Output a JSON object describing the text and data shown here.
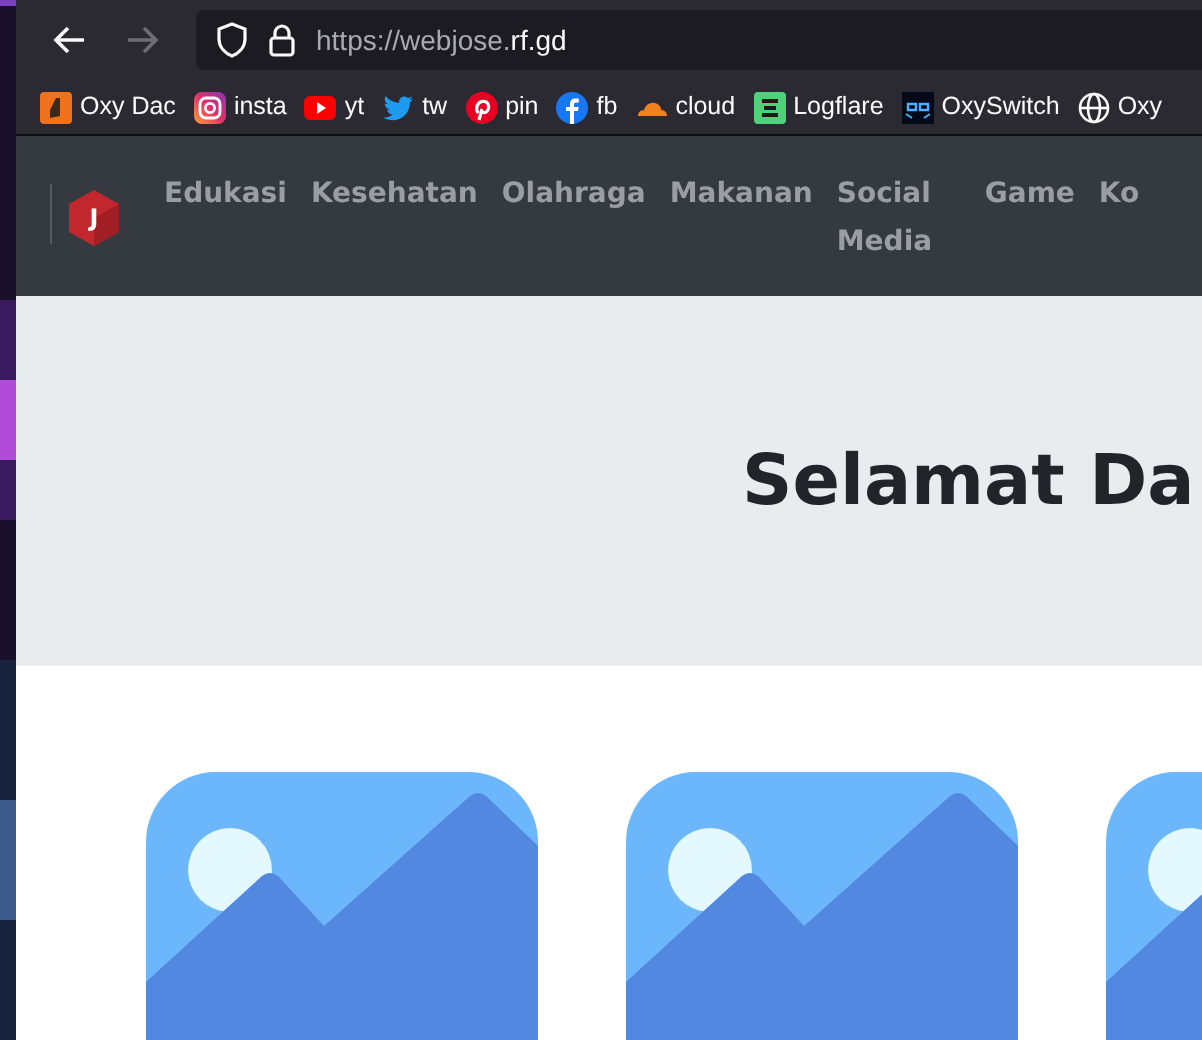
{
  "browser": {
    "back_disabled": false,
    "forward_disabled": true,
    "url": {
      "dim": "https://webjose.",
      "bright": "rf.gd"
    }
  },
  "bookmarks": [
    {
      "label": "Oxy Dac"
    },
    {
      "label": "insta"
    },
    {
      "label": "yt"
    },
    {
      "label": "tw"
    },
    {
      "label": "pin"
    },
    {
      "label": "fb"
    },
    {
      "label": "cloud"
    },
    {
      "label": "Logflare"
    },
    {
      "label": "OxySwitch"
    },
    {
      "label": "Oxy"
    }
  ],
  "navbar": {
    "logo_letter": "J",
    "items": [
      {
        "label": "Edukasi"
      },
      {
        "label": "Kesehatan"
      },
      {
        "label": "Olahraga"
      },
      {
        "label": "Makanan"
      },
      {
        "label": "Social Media"
      },
      {
        "label": "Game"
      },
      {
        "label": "Ko"
      }
    ]
  },
  "hero": {
    "title": "Selamat Da"
  }
}
